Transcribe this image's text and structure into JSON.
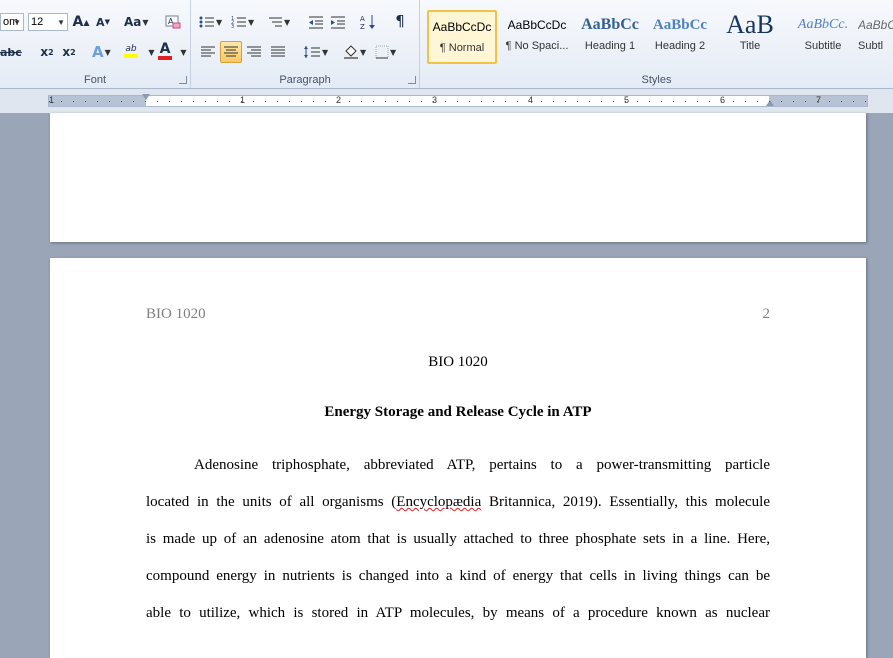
{
  "ribbon": {
    "font_group": {
      "label": "Font",
      "font_name_fragment": "om",
      "font_size": "12",
      "grow_font": "A",
      "shrink_font": "A",
      "change_case": "Aa",
      "strikethrough": "abc",
      "subscript": "x",
      "subscript_mark": "2",
      "superscript": "x",
      "superscript_mark": "2",
      "text_effects": "A",
      "highlight": "ab",
      "font_color": "A"
    },
    "paragraph_group": {
      "label": "Paragraph",
      "show_marks": "¶"
    },
    "styles_group": {
      "label": "Styles",
      "items": [
        {
          "sample": "AaBbCcDc",
          "name": "¶ Normal"
        },
        {
          "sample": "AaBbCcDc",
          "name": "¶ No Spaci..."
        },
        {
          "sample": "AaBbCc",
          "name": "Heading 1"
        },
        {
          "sample": "AaBbCc",
          "name": "Heading 2"
        },
        {
          "sample": "AaB",
          "name": "Title"
        },
        {
          "sample": "AaBbCc.",
          "name": "Subtitle"
        },
        {
          "sample": "AaBbC",
          "name": "Subtl"
        }
      ]
    }
  },
  "ruler": {
    "numbers": [
      "1",
      "1",
      "2",
      "3",
      "4",
      "5",
      "6",
      "7"
    ]
  },
  "document": {
    "header_left": "BIO 1020",
    "header_right": "2",
    "course_line": "BIO 1020",
    "title": "Energy Storage and Release Cycle in ATP",
    "lines": [
      "Adenosine triphosphate, abbreviated ATP, pertains to a power-transmitting particle",
      "located in the units of all organisms (",
      "Encyclopædia",
      " Britannica, 2019). Essentially, this molecule",
      "is made up of an adenosine atom that is usually attached to three phosphate sets in a line. Here,",
      "compound energy in nutrients is changed into a kind of energy that cells in living things can be",
      "able to utilize, which is stored in ATP molecules, by means of a procedure known as nuclear"
    ]
  },
  "colors": {
    "ribbon_bg": "#e4ebf5",
    "workspace_bg": "#9aa6b8",
    "selected_style": "#f0c24a",
    "header_text": "#7f7f7f",
    "spell_error": "#e02020"
  }
}
